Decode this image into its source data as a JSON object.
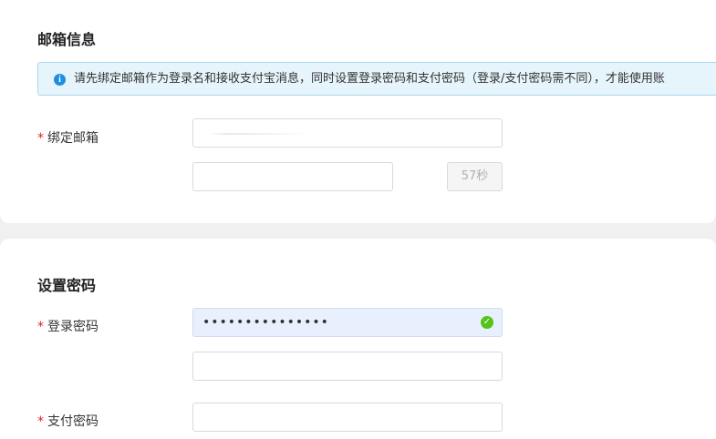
{
  "email_section": {
    "title": "邮箱信息",
    "info_banner": "请先绑定邮箱作为登录名和接收支付宝消息，同时设置登录密码和支付密码（登录/支付密码需不同），才能使用账",
    "email_label": "绑定邮箱",
    "email_value": "",
    "code_value": "",
    "countdown_label": "57秒"
  },
  "password_section": {
    "title": "设置密码",
    "login_password_label": "登录密码",
    "login_password_value": "•••••••••••••••",
    "login_password_confirm_value": "",
    "pay_password_label": "支付密码",
    "pay_password_value": ""
  },
  "required_mark": "*",
  "colors": {
    "banner_bg": "#e6f4fb",
    "banner_border": "#a8d8f0",
    "info_icon": "#1d8fe1",
    "success_icon": "#52c41a",
    "required": "#e02020"
  },
  "icons": {
    "info": "info-circle-icon",
    "valid": "check-circle-icon"
  }
}
